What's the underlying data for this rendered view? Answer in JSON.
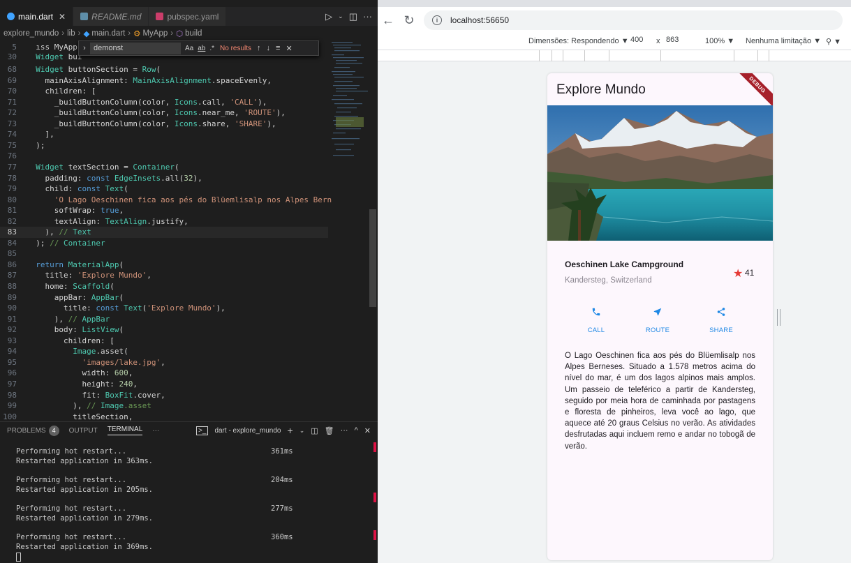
{
  "vscode": {
    "tabs": [
      {
        "label": "main.dart",
        "close": "✕",
        "color": "#40a3ff"
      },
      {
        "label": "README.md",
        "color": "#5e8ea8"
      },
      {
        "label": "pubspec.yaml",
        "color": "#cb3d6a"
      }
    ],
    "breadcrumb": [
      "explore_mundo",
      "lib",
      "main.dart",
      "MyApp",
      "build"
    ],
    "find": {
      "value": "demonst",
      "aa": "Aa",
      "ab": "ab",
      "regex": ".*",
      "result": "No results"
    },
    "code_lines": [
      {
        "n": "5",
        "t": "  ıss MyApp"
      },
      {
        "n": "30",
        "t": "  Widget bui"
      },
      {
        "n": "68",
        "t": "  Widget buttonSection = Row("
      },
      {
        "n": "69",
        "t": "    mainAxisAlignment: MainAxisAlignment.spaceEvenly,"
      },
      {
        "n": "70",
        "t": "    children: ["
      },
      {
        "n": "71",
        "t": "      _buildButtonColumn(color, Icons.call, 'CALL'),"
      },
      {
        "n": "72",
        "t": "      _buildButtonColumn(color, Icons.near_me, 'ROUTE'),"
      },
      {
        "n": "73",
        "t": "      _buildButtonColumn(color, Icons.share, 'SHARE'),"
      },
      {
        "n": "74",
        "t": "    ],"
      },
      {
        "n": "75",
        "t": "  );"
      },
      {
        "n": "76",
        "t": ""
      },
      {
        "n": "77",
        "t": "  Widget textSection = Container("
      },
      {
        "n": "78",
        "t": "    padding: const EdgeInsets.all(32),"
      },
      {
        "n": "79",
        "t": "    child: const Text("
      },
      {
        "n": "80",
        "t": "      'O Lago Oeschinen fica aos pés do Blüemlisalp nos Alpes Bern"
      },
      {
        "n": "81",
        "t": "      softWrap: true,"
      },
      {
        "n": "82",
        "t": "      textAlign: TextAlign.justify,"
      },
      {
        "n": "83",
        "t": "    ), // Text"
      },
      {
        "n": "84",
        "t": "  ); // Container"
      },
      {
        "n": "85",
        "t": ""
      },
      {
        "n": "86",
        "t": "  return MaterialApp("
      },
      {
        "n": "87",
        "t": "    title: 'Explore Mundo',"
      },
      {
        "n": "88",
        "t": "    home: Scaffold("
      },
      {
        "n": "89",
        "t": "      appBar: AppBar("
      },
      {
        "n": "90",
        "t": "        title: const Text('Explore Mundo'),"
      },
      {
        "n": "91",
        "t": "      ), // AppBar"
      },
      {
        "n": "92",
        "t": "      body: ListView("
      },
      {
        "n": "93",
        "t": "        children: ["
      },
      {
        "n": "94",
        "t": "          Image.asset("
      },
      {
        "n": "95",
        "t": "            'images/lake.jpg',"
      },
      {
        "n": "96",
        "t": "            width: 600,"
      },
      {
        "n": "97",
        "t": "            height: 240,"
      },
      {
        "n": "98",
        "t": "            fit: BoxFit.cover,"
      },
      {
        "n": "99",
        "t": "          ), // Image.asset"
      },
      {
        "n": "100",
        "t": "          titleSection,"
      }
    ],
    "panel": {
      "tabs": [
        "PROBLEMS",
        "OUTPUT",
        "TERMINAL",
        "···"
      ],
      "problems_count": "4",
      "terminal_name": "dart - explore_mundo"
    },
    "terminal": [
      {
        "a": "Performing hot restart...",
        "ms": "361ms",
        "b": "Restarted application in 363ms."
      },
      {
        "a": "Performing hot restart...",
        "ms": "204ms",
        "b": "Restarted application in 205ms."
      },
      {
        "a": "Performing hot restart...",
        "ms": "277ms",
        "b": "Restarted application in 279ms."
      },
      {
        "a": "Performing hot restart...",
        "ms": "360ms",
        "b": "Restarted application in 369ms."
      }
    ]
  },
  "browser": {
    "url": "localhost:56650",
    "devtools": {
      "dimensions": "Dimensões: Respondendo ▼",
      "width": "400",
      "x": "x",
      "height": "863",
      "zoom": "100% ▼",
      "throttle": "Nenhuma limitação ▼"
    }
  },
  "app": {
    "title": "Explore Mundo",
    "debug": "DEBUG",
    "place_name": "Oeschinen Lake Campground",
    "place_location": "Kandersteg, Switzerland",
    "stars": "41",
    "buttons": [
      {
        "label": "CALL",
        "icon": "phone-icon"
      },
      {
        "label": "ROUTE",
        "icon": "near-me-icon"
      },
      {
        "label": "SHARE",
        "icon": "share-icon"
      }
    ],
    "description": "O Lago Oeschinen fica aos pés do Blüemlisalp nos Alpes Berneses. Situado a 1.578 metros acima do nível do mar, é um dos lagos alpinos mais amplos. Um passeio de teleférico a partir de Kandersteg, seguido por meia hora de caminhada por pastagens e floresta de pinheiros, leva você ao lago, que aquece até 20 graus Celsius no verão. As atividades desfrutadas aqui incluem remo e andar no tobogã de verão.",
    "accent": "#1e88e5"
  }
}
